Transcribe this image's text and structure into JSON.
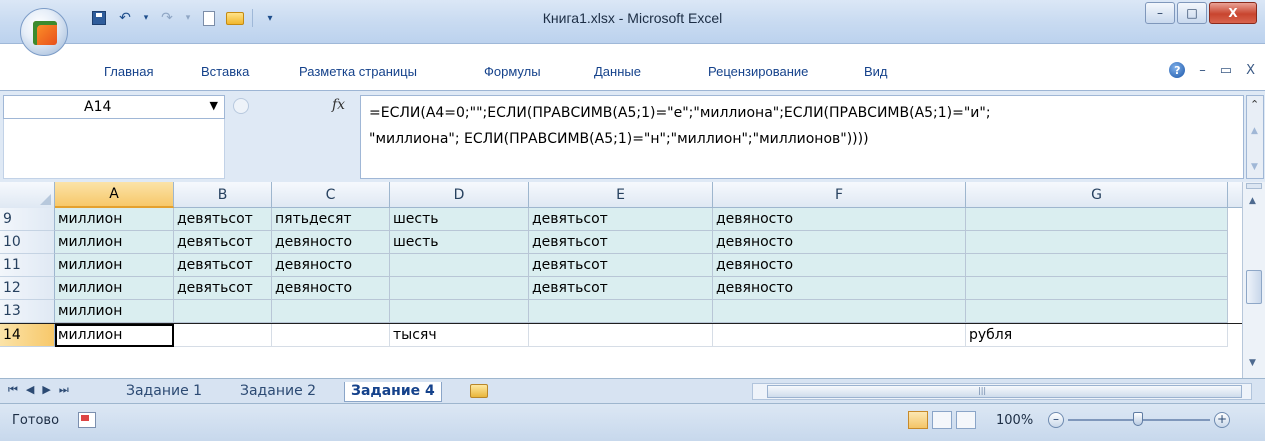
{
  "window": {
    "title": "Книга1.xlsx - Microsoft Excel",
    "controls": {
      "minimize": "–",
      "maximize": "□",
      "close": "X"
    }
  },
  "ribbon": {
    "tabs": [
      "Главная",
      "Вставка",
      "Разметка страницы",
      "Формулы",
      "Данные",
      "Рецензирование",
      "Вид"
    ],
    "right": {
      "help": "?",
      "minimize": "–",
      "restore": "▭",
      "close": "X"
    }
  },
  "formula_bar": {
    "name_box": "A14",
    "fx": "fx",
    "formula_line1": "=ЕСЛИ(A4=0;\"\";ЕСЛИ(ПРАВСИМВ(A5;1)=\"е\";\"миллиона\";ЕСЛИ(ПРАВСИМВ(A5;1)=\"и\";",
    "formula_line2": "\"миллиона\"; ЕСЛИ(ПРАВСИМВ(A5;1)=\"н\";\"миллион\";\"миллионов\"))))"
  },
  "grid": {
    "columns": [
      "A",
      "B",
      "C",
      "D",
      "E",
      "F",
      "G"
    ],
    "selected_column": "A",
    "rows": [
      {
        "num": "9",
        "cells": [
          "миллион",
          "девятьсот",
          "пятьдесят",
          "шесть",
          "девятьсот",
          "девяносто",
          ""
        ]
      },
      {
        "num": "10",
        "cells": [
          "миллион",
          "девятьсот",
          "девяносто",
          "шесть",
          "девятьсот",
          "девяносто",
          ""
        ]
      },
      {
        "num": "11",
        "cells": [
          "миллион",
          "девятьсот",
          "девяносто",
          "",
          "девятьсот",
          "девяносто",
          ""
        ]
      },
      {
        "num": "12",
        "cells": [
          "миллион",
          "девятьсот",
          "девяносто",
          "",
          "девятьсот",
          "девяносто",
          ""
        ]
      },
      {
        "num": "13",
        "cells": [
          "миллион",
          "",
          "",
          "",
          "",
          "",
          ""
        ]
      },
      {
        "num": "14",
        "cells": [
          "миллион",
          "",
          "",
          "тысяч",
          "",
          "",
          "рубля"
        ]
      }
    ],
    "active_row": "14",
    "active_cell": "A14"
  },
  "sheets": {
    "tabs": [
      "Задание 1",
      "Задание 2",
      "Задание 4"
    ],
    "active": "Задание 4"
  },
  "status": {
    "ready": "Готово",
    "zoom": "100%",
    "zoom_minus": "–",
    "zoom_plus": "+"
  }
}
